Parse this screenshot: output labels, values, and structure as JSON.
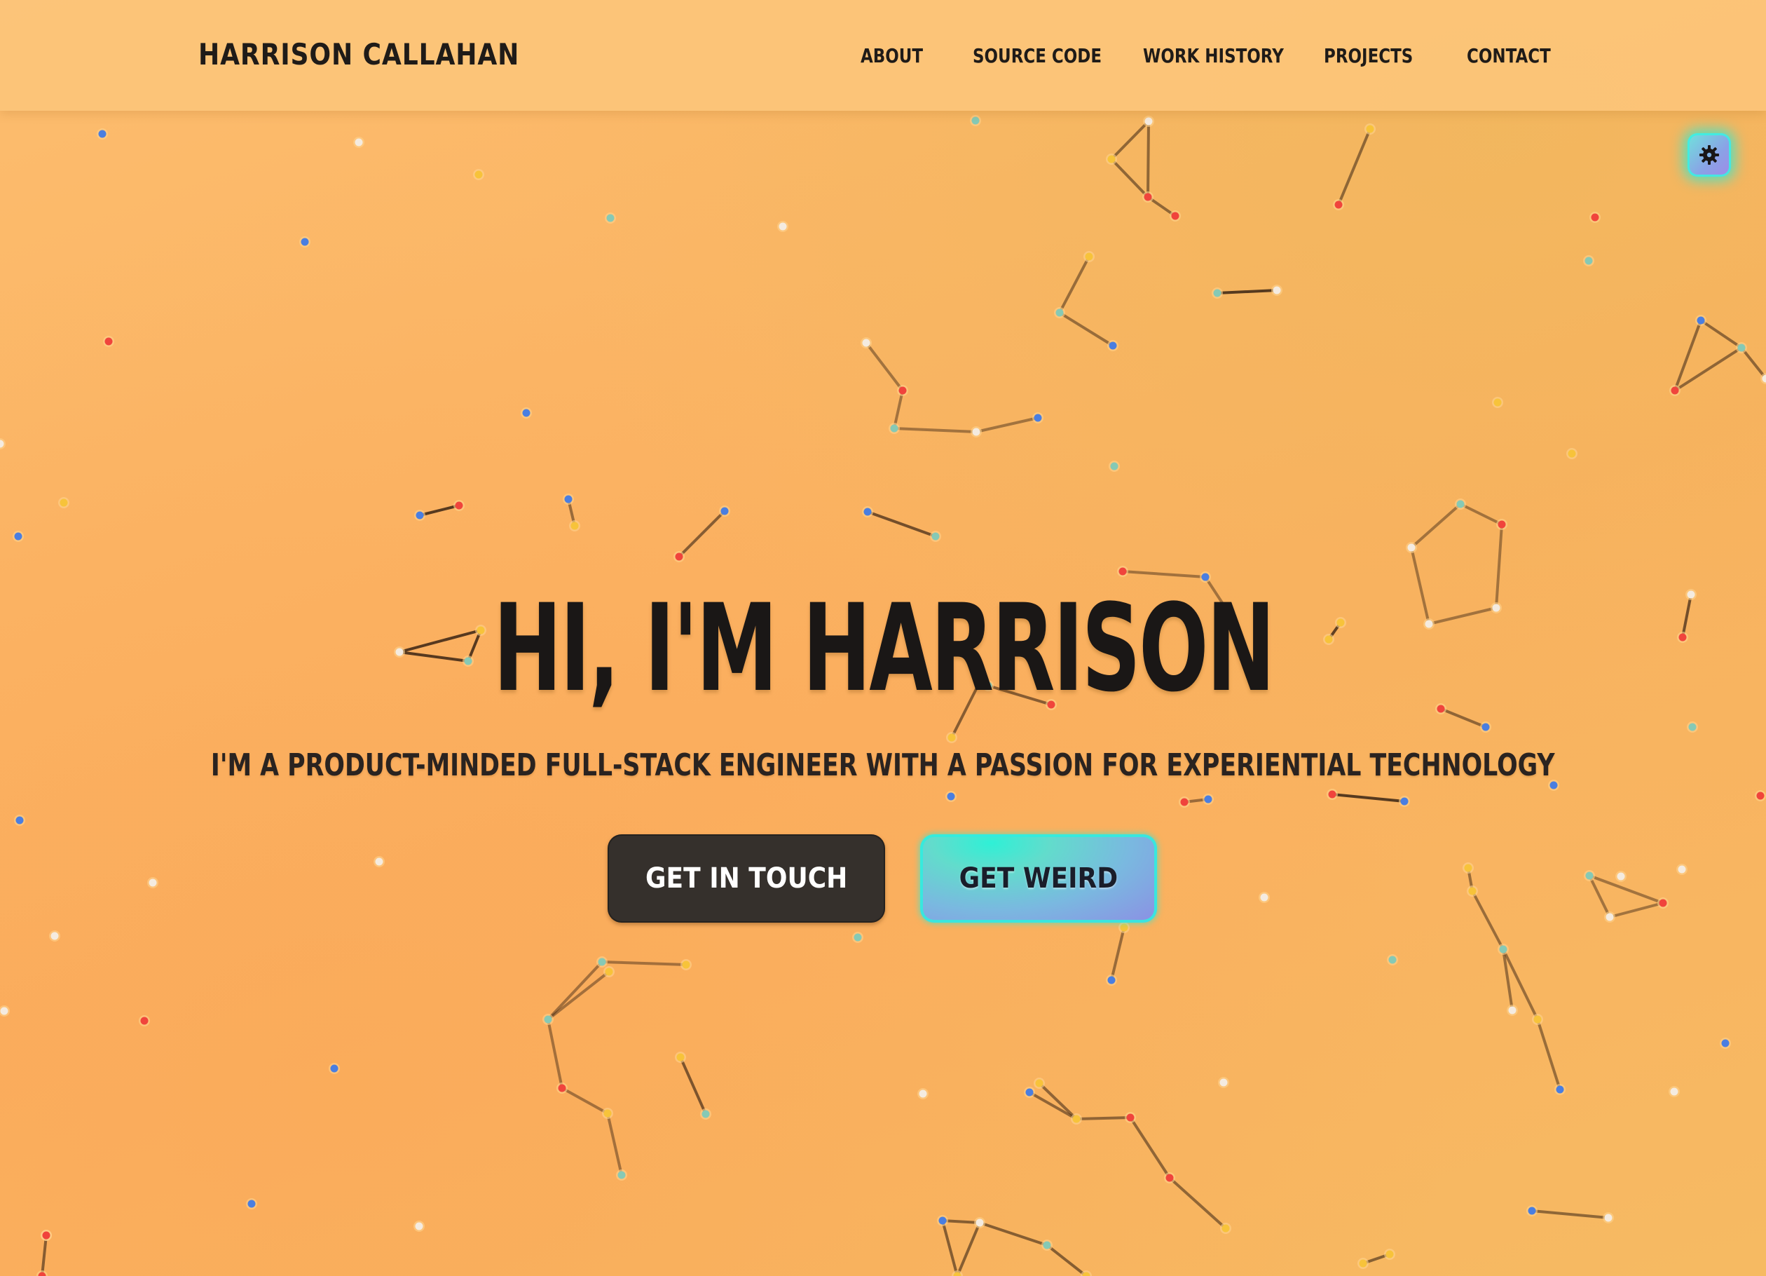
{
  "header": {
    "brand": "HARRISON CALLAHAN",
    "nav": [
      {
        "label": "ABOUT"
      },
      {
        "label": "SOURCE CODE"
      },
      {
        "label": "WORK HISTORY"
      },
      {
        "label": "PROJECTS"
      },
      {
        "label": "CONTACT"
      }
    ]
  },
  "theme_toggle": {
    "icon": "gear-icon"
  },
  "hero": {
    "title": "HI, I'M HARRISON",
    "subtitle": "I'M A PRODUCT-MINDED FULL-STACK ENGINEER WITH A PASSION FOR EXPERIENTIAL TECHNOLOGY",
    "primary_button": "GET IN TOUCH",
    "secondary_button": "GET WEIRD"
  },
  "colors": {
    "background": "#fbb565",
    "header": "#fcc47a",
    "text": "#1a1716",
    "dark_button": "#35302c",
    "accent_teal": "#2ff0d6",
    "accent_violet": "#8c8fe4",
    "dot_red": "#f0443c",
    "dot_blue": "#4a7ee0",
    "dot_teal": "#86c9b5",
    "dot_yellow": "#f7c33a",
    "dot_white": "#f4ebe0"
  }
}
